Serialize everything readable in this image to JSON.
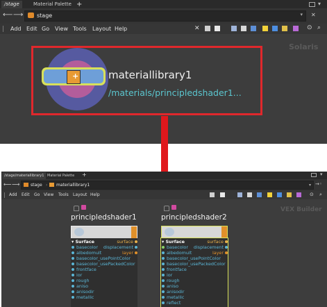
{
  "top": {
    "tabs": [
      "/stage",
      "Material Palette"
    ],
    "tab_add": "+",
    "path": "stage",
    "menu": [
      "Add",
      "Edit",
      "Go",
      "View",
      "Tools",
      "Layout",
      "Help"
    ],
    "context": "Solaris",
    "node": {
      "name": "materiallibrary1",
      "material_path": "/materials/principledshader1..."
    }
  },
  "bottom": {
    "tabs": [
      "/stage/materiallibrary1",
      "Material Palette"
    ],
    "tab_add": "+",
    "path_segments": [
      "stage",
      "materiallibrary1"
    ],
    "menu": [
      "Add",
      "Edit",
      "Go",
      "View",
      "Tools",
      "Layout",
      "Help"
    ],
    "context": "VEX Builder",
    "shaders": [
      {
        "name": "principledshader1",
        "output_header": "Surface",
        "outputs": [
          "surface",
          "displacement",
          "layer"
        ],
        "inputs": [
          "basecolor",
          "albedomult",
          "basecolor_usePointColor",
          "basecolor_usePackedColor",
          "frontface",
          "ior",
          "rough",
          "aniso",
          "anisodir",
          "metallic"
        ]
      },
      {
        "name": "principledshader2",
        "output_header": "Surface",
        "outputs": [
          "surface",
          "displacement",
          "layer"
        ],
        "inputs": [
          "basecolor",
          "albedomult",
          "basecolor_usePointColor",
          "basecolor_usePackedColor",
          "frontface",
          "ior",
          "rough",
          "aniso",
          "anisodir",
          "metallic",
          "reflect"
        ]
      }
    ]
  },
  "colors": {
    "highlight_box": "#e0282c",
    "arrow": "#e0181c",
    "node_path": "#5bc6cf",
    "param_input": "#5bb6d6",
    "output_surface": "#e8b04a",
    "output_layer": "#e0902a"
  }
}
